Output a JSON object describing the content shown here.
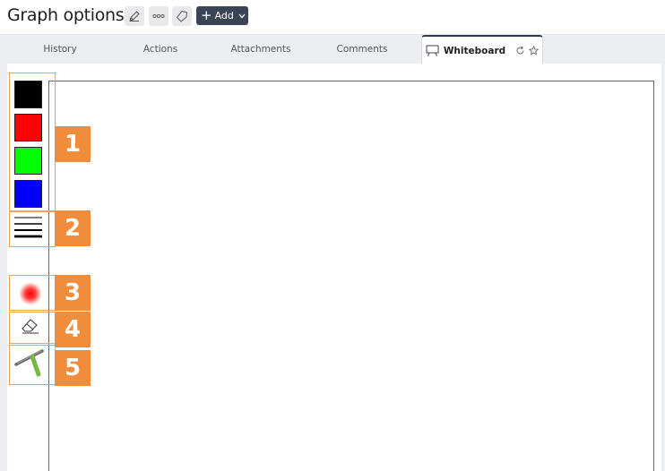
{
  "header": {
    "title": "Graph options",
    "add_label": "Add",
    "icons": [
      "pencil-icon",
      "more-icon",
      "tag-icon"
    ]
  },
  "tabs": [
    {
      "label": "History",
      "active": false
    },
    {
      "label": "Actions",
      "active": false
    },
    {
      "label": "Attachments",
      "active": false
    },
    {
      "label": "Comments",
      "active": false
    },
    {
      "label": "Whiteboard",
      "active": true
    }
  ],
  "whiteboard": {
    "colors": [
      "#000000",
      "#ff0000",
      "#00ff00",
      "#0000ff"
    ],
    "callouts": [
      "1",
      "2",
      "3",
      "4",
      "5"
    ]
  },
  "colors": {
    "accent": "#f08c3a",
    "header_button": "#3b4456"
  }
}
